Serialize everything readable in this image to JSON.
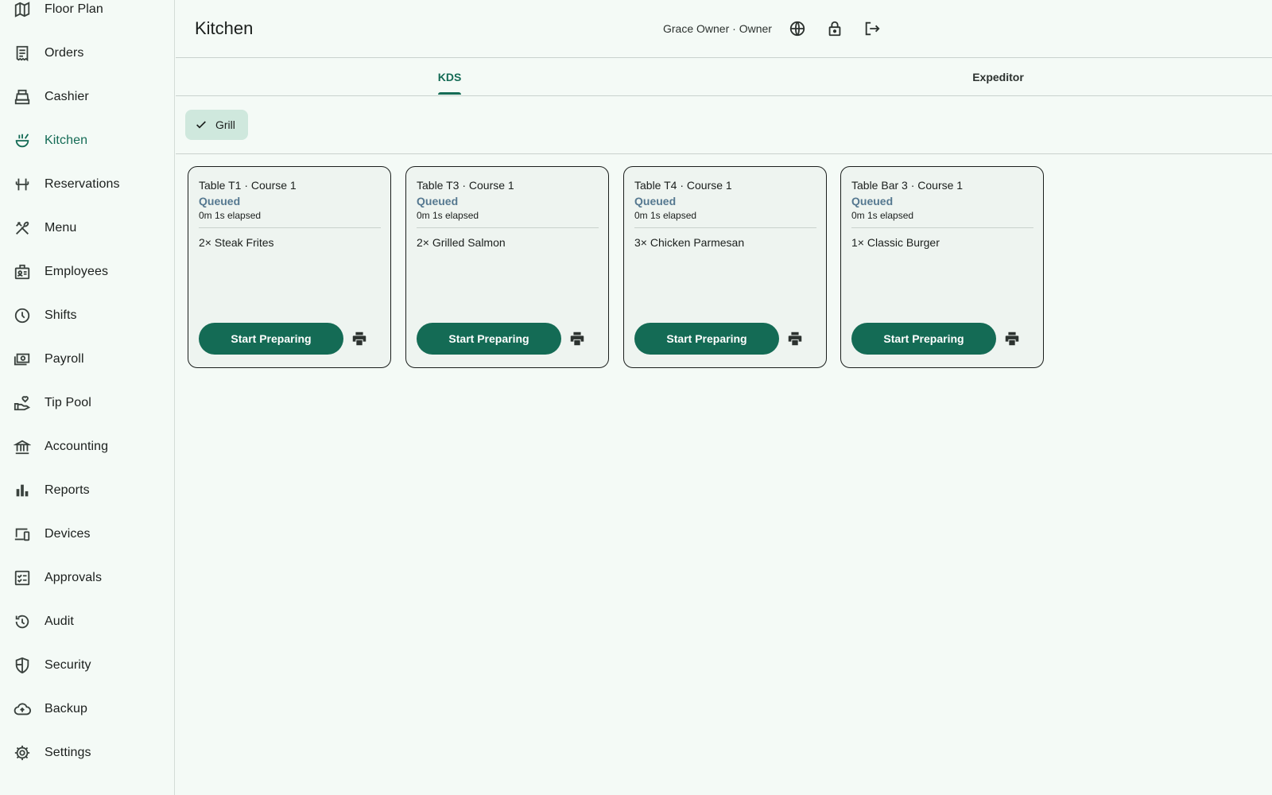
{
  "sidebar": {
    "items": [
      {
        "label": "Floor Plan",
        "icon": "map-icon"
      },
      {
        "label": "Orders",
        "icon": "receipt-icon"
      },
      {
        "label": "Cashier",
        "icon": "register-icon"
      },
      {
        "label": "Kitchen",
        "icon": "soup-icon",
        "active": true
      },
      {
        "label": "Reservations",
        "icon": "chair-icon"
      },
      {
        "label": "Menu",
        "icon": "utensils-icon"
      },
      {
        "label": "Employees",
        "icon": "badge-icon"
      },
      {
        "label": "Shifts",
        "icon": "clock-icon"
      },
      {
        "label": "Payroll",
        "icon": "money-icon"
      },
      {
        "label": "Tip Pool",
        "icon": "hand-heart-icon"
      },
      {
        "label": "Accounting",
        "icon": "bank-icon"
      },
      {
        "label": "Reports",
        "icon": "bar-chart-icon"
      },
      {
        "label": "Devices",
        "icon": "devices-icon"
      },
      {
        "label": "Approvals",
        "icon": "checklist-icon"
      },
      {
        "label": "Audit",
        "icon": "history-icon"
      },
      {
        "label": "Security",
        "icon": "shield-icon"
      },
      {
        "label": "Backup",
        "icon": "cloud-upload-icon"
      },
      {
        "label": "Settings",
        "icon": "gear-icon"
      }
    ]
  },
  "header": {
    "title": "Kitchen",
    "user": "Grace Owner · Owner",
    "icons": [
      "globe-icon",
      "lock-icon",
      "logout-icon"
    ]
  },
  "tabs": [
    {
      "label": "KDS",
      "active": true
    },
    {
      "label": "Expeditor",
      "active": false
    }
  ],
  "filter": {
    "chip_label": "Grill",
    "selected": true
  },
  "tickets": [
    {
      "title": "Table T1 · Course 1",
      "status": "Queued",
      "elapsed": "0m 1s elapsed",
      "items": [
        "2× Steak Frites"
      ],
      "action": "Start Preparing"
    },
    {
      "title": "Table T3 · Course 1",
      "status": "Queued",
      "elapsed": "0m 1s elapsed",
      "items": [
        "2× Grilled Salmon"
      ],
      "action": "Start Preparing"
    },
    {
      "title": "Table T4 · Course 1",
      "status": "Queued",
      "elapsed": "0m 1s elapsed",
      "items": [
        "3× Chicken Parmesan"
      ],
      "action": "Start Preparing"
    },
    {
      "title": "Table Bar 3 · Course 1",
      "status": "Queued",
      "elapsed": "0m 1s elapsed",
      "items": [
        "1× Classic Burger"
      ],
      "action": "Start Preparing"
    }
  ],
  "colors": {
    "accent": "#146b55",
    "status_queued": "#557890",
    "chip_bg": "#cfe8dd",
    "background": "#f4faf6"
  }
}
